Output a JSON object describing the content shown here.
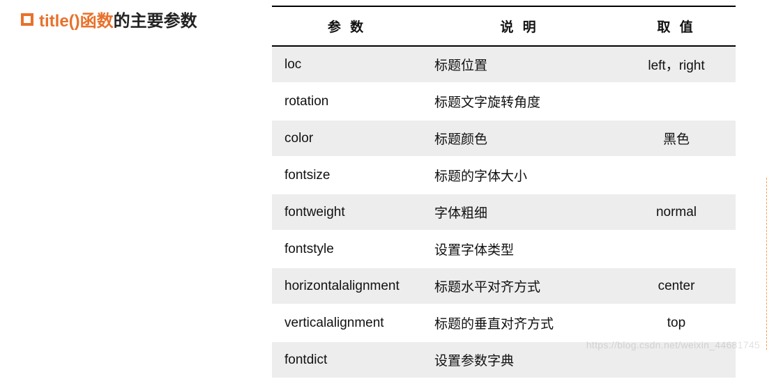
{
  "heading": {
    "highlight": "title()函数",
    "rest": "的主要参数"
  },
  "table": {
    "headers": [
      "参 数",
      "说 明",
      "取 值"
    ],
    "rows": [
      {
        "param": "loc",
        "desc": "标题位置",
        "value": "left，right"
      },
      {
        "param": "rotation",
        "desc": "标题文字旋转角度",
        "value": ""
      },
      {
        "param": "color",
        "desc": "标题颜色",
        "value": "黑色"
      },
      {
        "param": "fontsize",
        "desc": "标题的字体大小",
        "value": ""
      },
      {
        "param": "fontweight",
        "desc": "字体粗细",
        "value": "normal"
      },
      {
        "param": "fontstyle",
        "desc": "设置字体类型",
        "value": ""
      },
      {
        "param": "horizontalalignment",
        "desc": "标题水平对齐方式",
        "value": "center"
      },
      {
        "param": "verticalalignment",
        "desc": "标题的垂直对齐方式",
        "value": "top"
      },
      {
        "param": "fontdict",
        "desc": "设置参数字典",
        "value": ""
      }
    ]
  },
  "watermark": "https://blog.csdn.net/weixin_44681745"
}
